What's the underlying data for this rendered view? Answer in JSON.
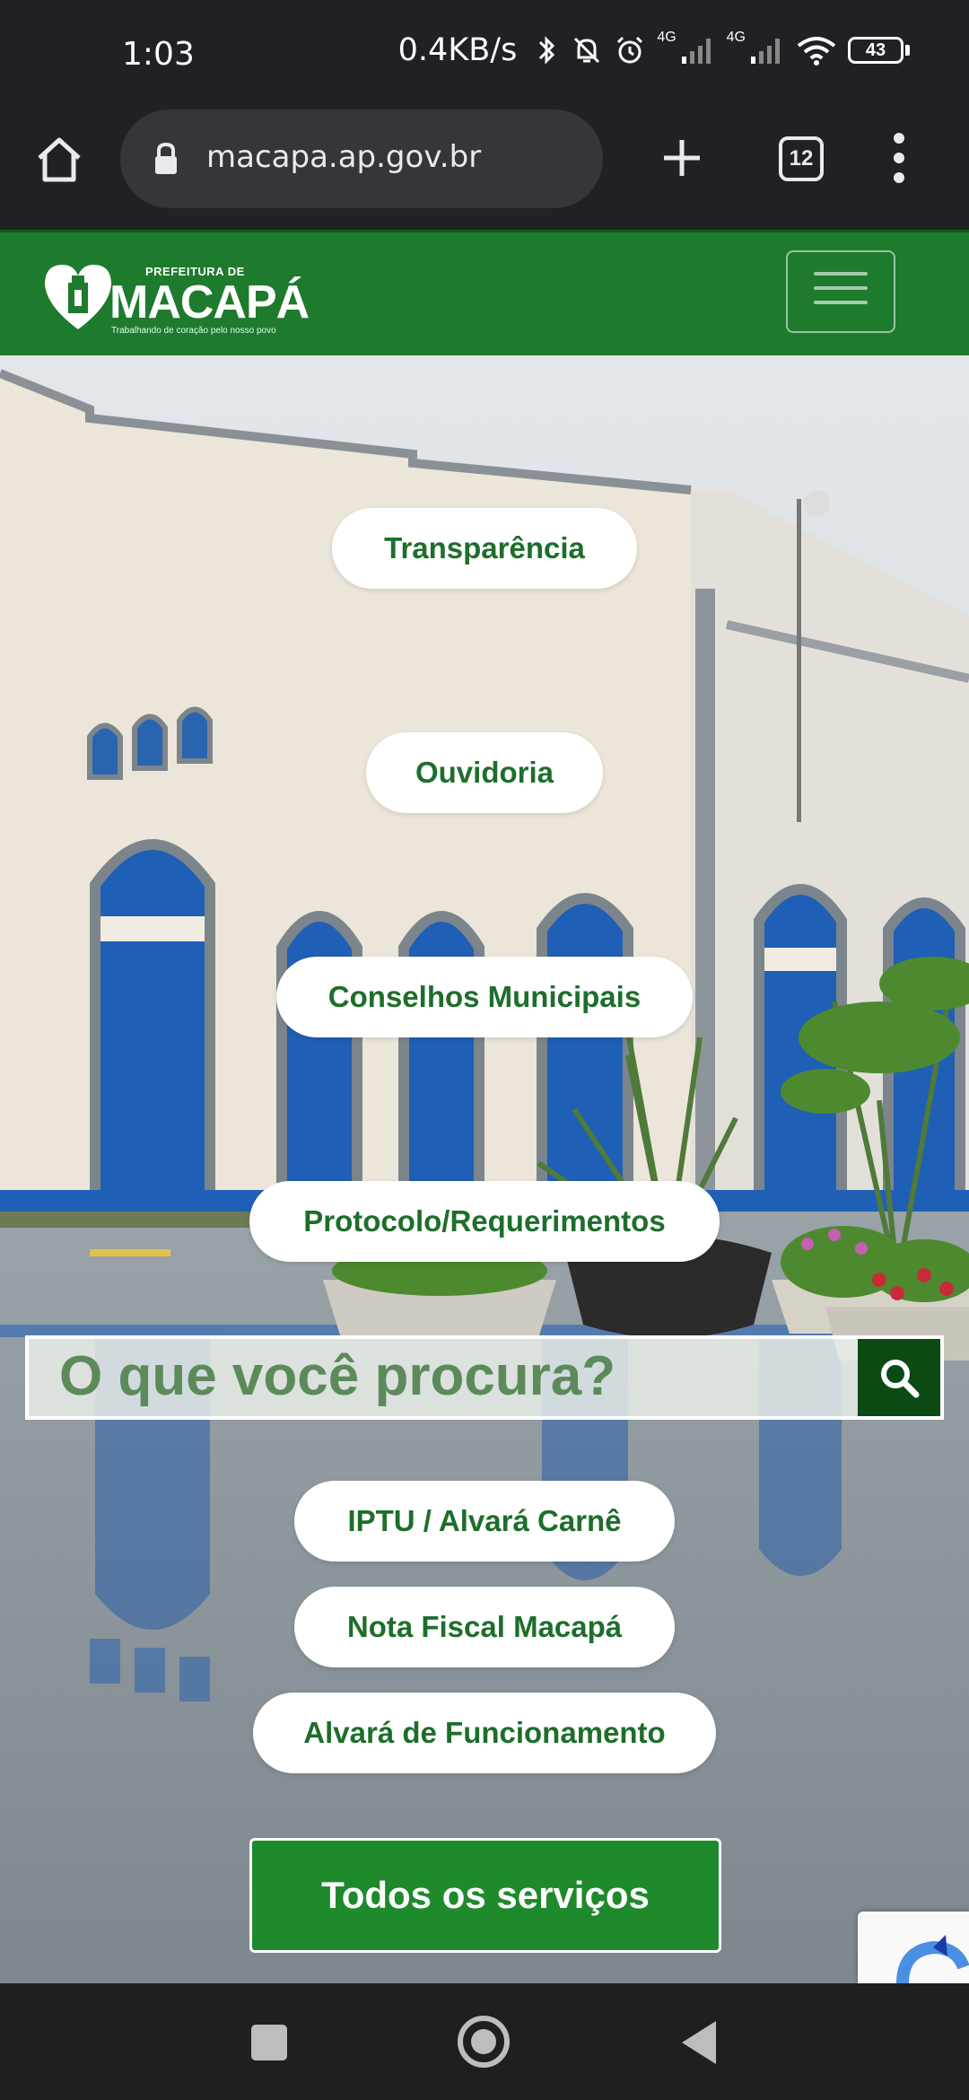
{
  "status_bar": {
    "time": "1:03",
    "net_speed": "0.4KB/s",
    "net1": "4G",
    "net2": "4G",
    "battery": "43"
  },
  "browser": {
    "url": "macapa.ap.gov.br",
    "tab_count": "12"
  },
  "header": {
    "logo_top": "PREFEITURA DE",
    "logo_name": "MACAPÁ",
    "logo_slogan": "Trabalhando de coração pelo nosso povo",
    "brand_color": "#1e7a2d"
  },
  "quick_links": [
    {
      "label": "Transparência"
    },
    {
      "label": "Ouvidoria"
    },
    {
      "label": "Conselhos Municipais"
    },
    {
      "label": "Protocolo/Requerimentos"
    }
  ],
  "search": {
    "placeholder": "O que você procura?"
  },
  "services": [
    {
      "label": "IPTU / Alvará Carnê"
    },
    {
      "label": "Nota Fiscal Macapá"
    },
    {
      "label": "Alvará de Funcionamento"
    }
  ],
  "all_services_label": "Todos os serviços"
}
